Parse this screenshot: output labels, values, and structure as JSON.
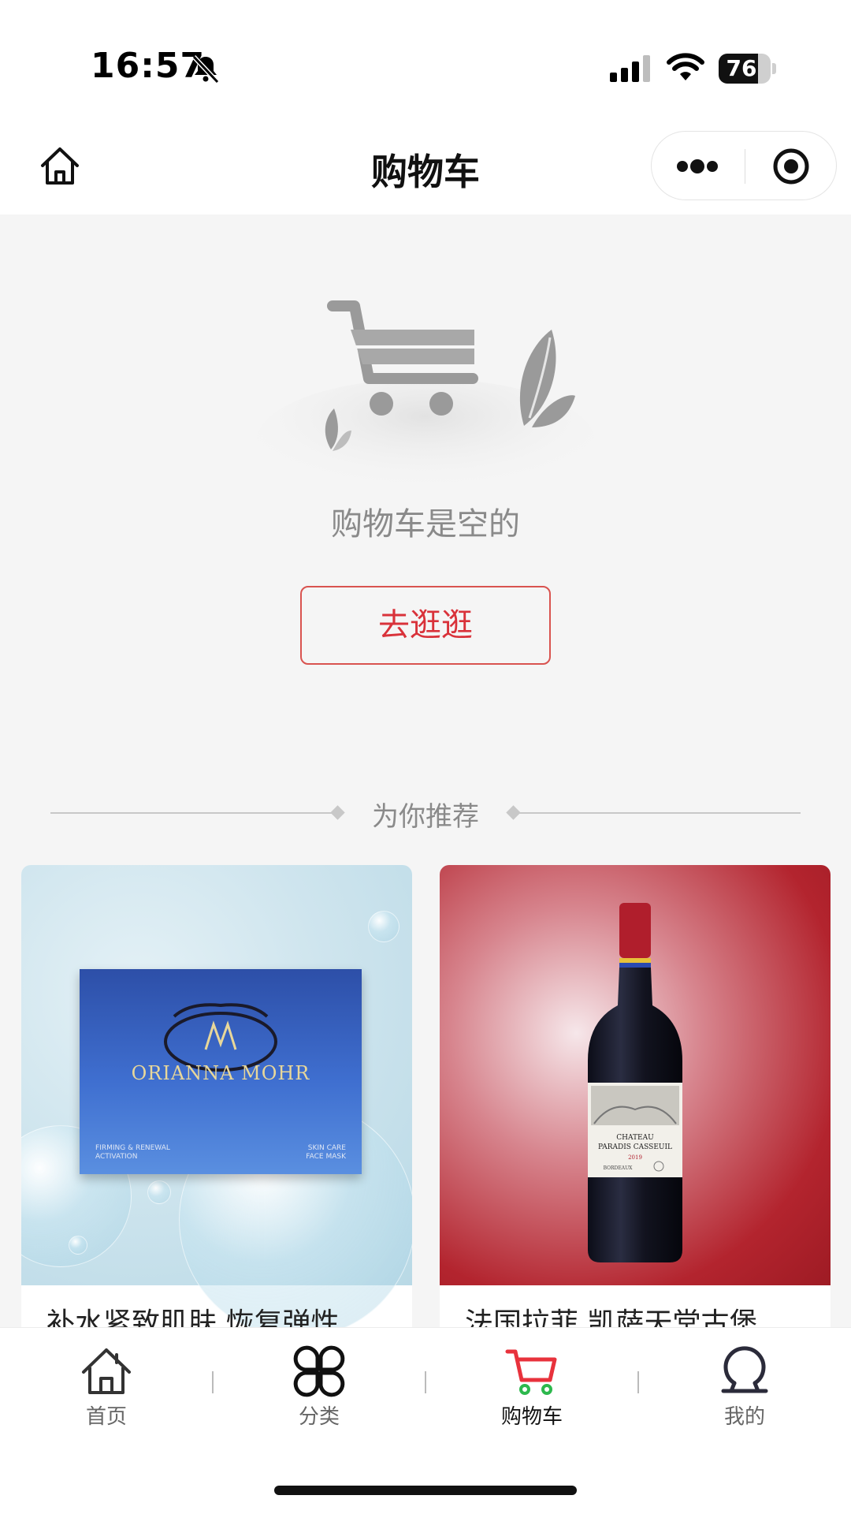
{
  "status_bar": {
    "time": "16:57",
    "battery": "76",
    "battery_level": 0.76
  },
  "nav": {
    "title": "购物车"
  },
  "empty_state": {
    "message": "购物车是空的",
    "button_label": "去逛逛"
  },
  "recommend": {
    "title": "为你推荐"
  },
  "products": [
    {
      "name": "补水紧致肌肤 恢复弹性",
      "image_brand": "ORIANNA MOHR",
      "image_sub_left": "FIRMING & RENEWAL\nACTIVATION",
      "image_sub_right": "SKIN CARE\nFACE MASK"
    },
    {
      "name": "法国拉菲 凯萨天堂古堡",
      "image_label_1": "CHATEAU",
      "image_label_2": "PARADIS CASSEUIL",
      "image_label_3": "2019",
      "image_label_4": "BORDEAUX"
    }
  ],
  "tab_bar": {
    "tabs": [
      {
        "label": "首页",
        "icon": "home-icon"
      },
      {
        "label": "分类",
        "icon": "category-icon"
      },
      {
        "label": "购物车",
        "icon": "cart-icon"
      },
      {
        "label": "我的",
        "icon": "profile-icon"
      }
    ],
    "active_index": 2,
    "active_color": "#e8323c",
    "active_accent": "#2db84d"
  }
}
